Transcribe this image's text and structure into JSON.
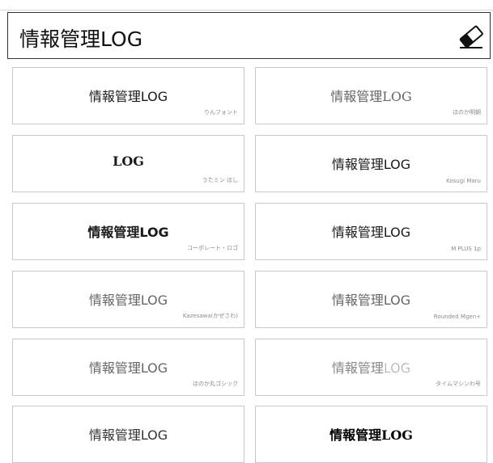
{
  "input": {
    "value": "情報管理LOG"
  },
  "cards": [
    {
      "sample": "情報管理LOG",
      "font": "りんフォント"
    },
    {
      "sample": "情報管理LOG",
      "font": "ほのか明朝"
    },
    {
      "sample": "LOG",
      "font": "うたミン ほし"
    },
    {
      "sample": "情報管理LOG",
      "font": "Kosugi Maru"
    },
    {
      "sample": "情報管理LOG",
      "font": "コーポレート・ロゴ"
    },
    {
      "sample": "情報管理LOG",
      "font": "M PLUS 1p"
    },
    {
      "sample": "情報管理LOG",
      "font": "Kazesawa(かぜさわ)"
    },
    {
      "sample": "情報管理LOG",
      "font": "Rounded Mgen+"
    },
    {
      "sample": "情報管理LOG",
      "font": "ほのか丸ゴシック"
    },
    {
      "sample": "情報管理LOG",
      "font": "タイムマシンわ号"
    },
    {
      "sample": "情報管理LOG",
      "font": ""
    },
    {
      "sample": "情報管理LOG",
      "font": ""
    }
  ]
}
